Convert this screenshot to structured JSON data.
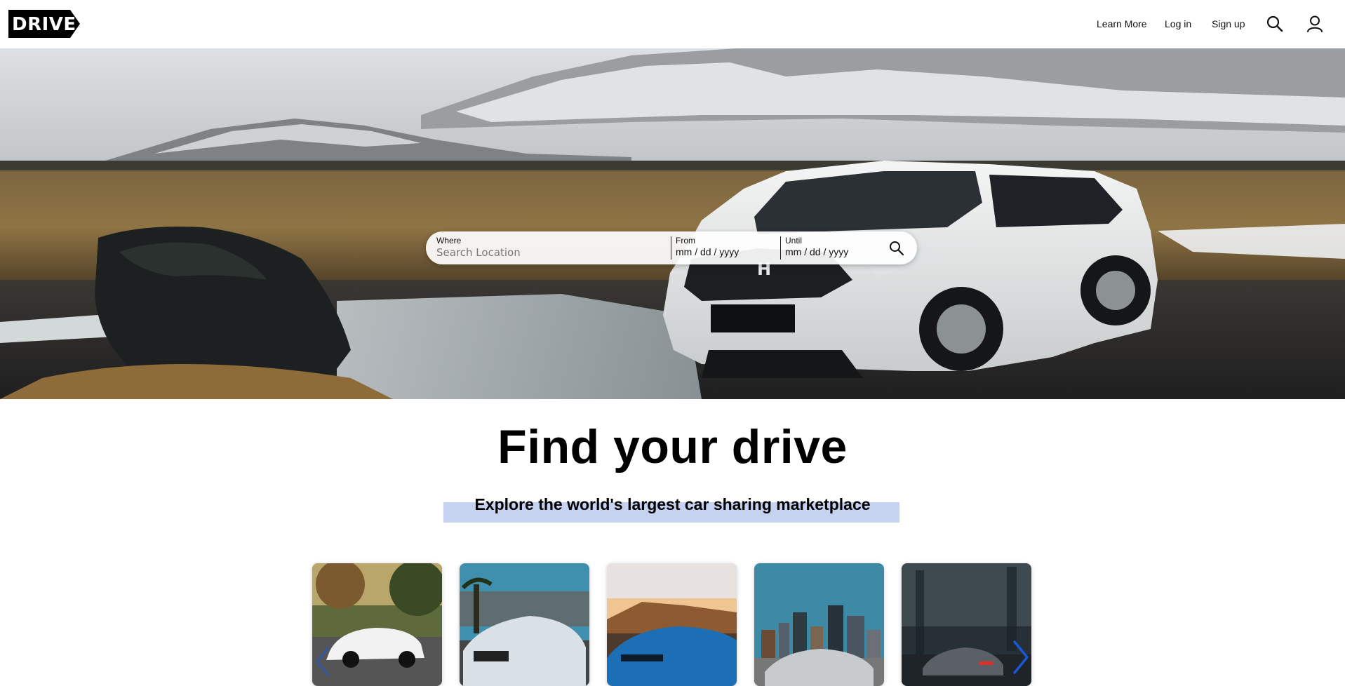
{
  "header": {
    "logo_text": "DRIVE",
    "nav": [
      {
        "label": "Learn More"
      },
      {
        "label": "Log in"
      },
      {
        "label": "Sign up"
      }
    ],
    "icons": [
      "search-icon",
      "user-icon"
    ]
  },
  "search": {
    "where_label": "Where",
    "where_placeholder": "Search Location",
    "from_label": "From",
    "from_placeholder": "mm / dd / yyyy",
    "until_label": "Until",
    "until_placeholder": "mm / dd / yyyy",
    "icon": "search-icon"
  },
  "main": {
    "headline": "Find your drive",
    "subheadline": "Explore the world's largest car sharing marketplace"
  },
  "carousel": {
    "cards": [
      {
        "icon": "car-photo",
        "accent": "#ffffff"
      },
      {
        "icon": "car-photo",
        "accent": "#d9e0e6"
      },
      {
        "icon": "car-photo",
        "accent": "#1c6fb5"
      },
      {
        "icon": "car-photo",
        "accent": "#c8cbce"
      },
      {
        "icon": "car-photo",
        "accent": "#5b5f66"
      }
    ],
    "prev_icon": "chevron-left-icon",
    "next_icon": "chevron-right-icon",
    "arrow_color": "#1a57d6"
  },
  "colors": {
    "subhead_highlight": "#c5d3f1",
    "logo_bg": "#000000"
  }
}
